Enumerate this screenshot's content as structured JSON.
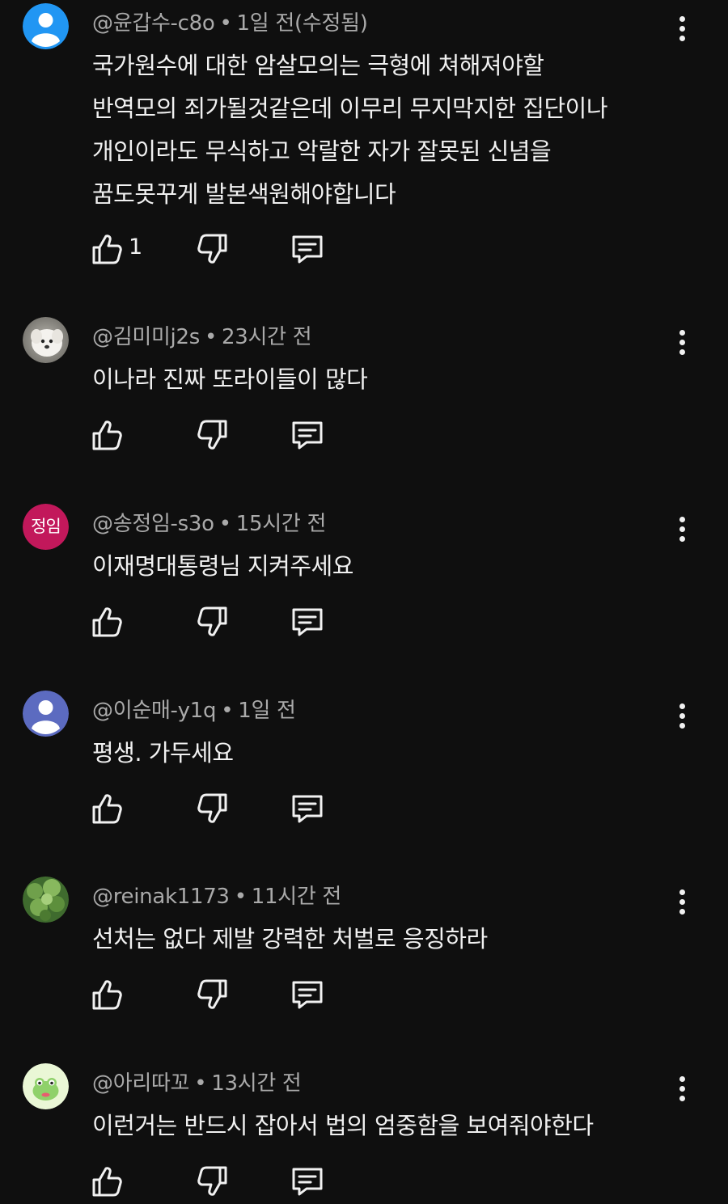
{
  "comments": [
    {
      "author": "@윤갑수-c8o",
      "time": "1일 전(수정됨)",
      "text": "국가원수에 대한 암살모의는 극형에 쳐해져야할\n반역모의 죄가될것같은데 이무리 무지막지한 집단이나\n개인이라도 무식하고 악랄한 자가 잘못된 신념을\n꿈도못꾸게  발본색원해야합니다",
      "likes": "1",
      "avatar": "default-person-blue"
    },
    {
      "author": "@김미미j2s",
      "time": "23시간 전",
      "text": "이나라 진짜 또라이들이 많다",
      "likes": "",
      "avatar": "photo-white-dog"
    },
    {
      "author": "@송정임-s3o",
      "time": "15시간 전",
      "text": "이재명대통령님 지켜주세요",
      "likes": "",
      "avatar": "initials",
      "initials": "정임"
    },
    {
      "author": "@이순매-y1q",
      "time": "1일 전",
      "text": "평생. 가두세요",
      "likes": "",
      "avatar": "default-person-indigo"
    },
    {
      "author": "@reinak1173",
      "time": "11시간 전",
      "text": "선처는 없다  제발 강력한 처벌로 응징하라",
      "likes": "",
      "avatar": "photo-green-leaves"
    },
    {
      "author": "@아리따꼬",
      "time": "13시간 전",
      "text": "이런거는 반드시 잡아서 법의 엄중함을 보여줘야한다",
      "likes": "",
      "avatar": "cartoon-frog"
    }
  ],
  "separator": "•",
  "colors": {
    "background": "#0f0f0f",
    "text_primary": "#f1f1f1",
    "text_secondary": "#aaaaaa",
    "avatar_blue": "#2196f3",
    "avatar_indigo": "#5c6bc0",
    "avatar_pink": "#c2185b"
  }
}
